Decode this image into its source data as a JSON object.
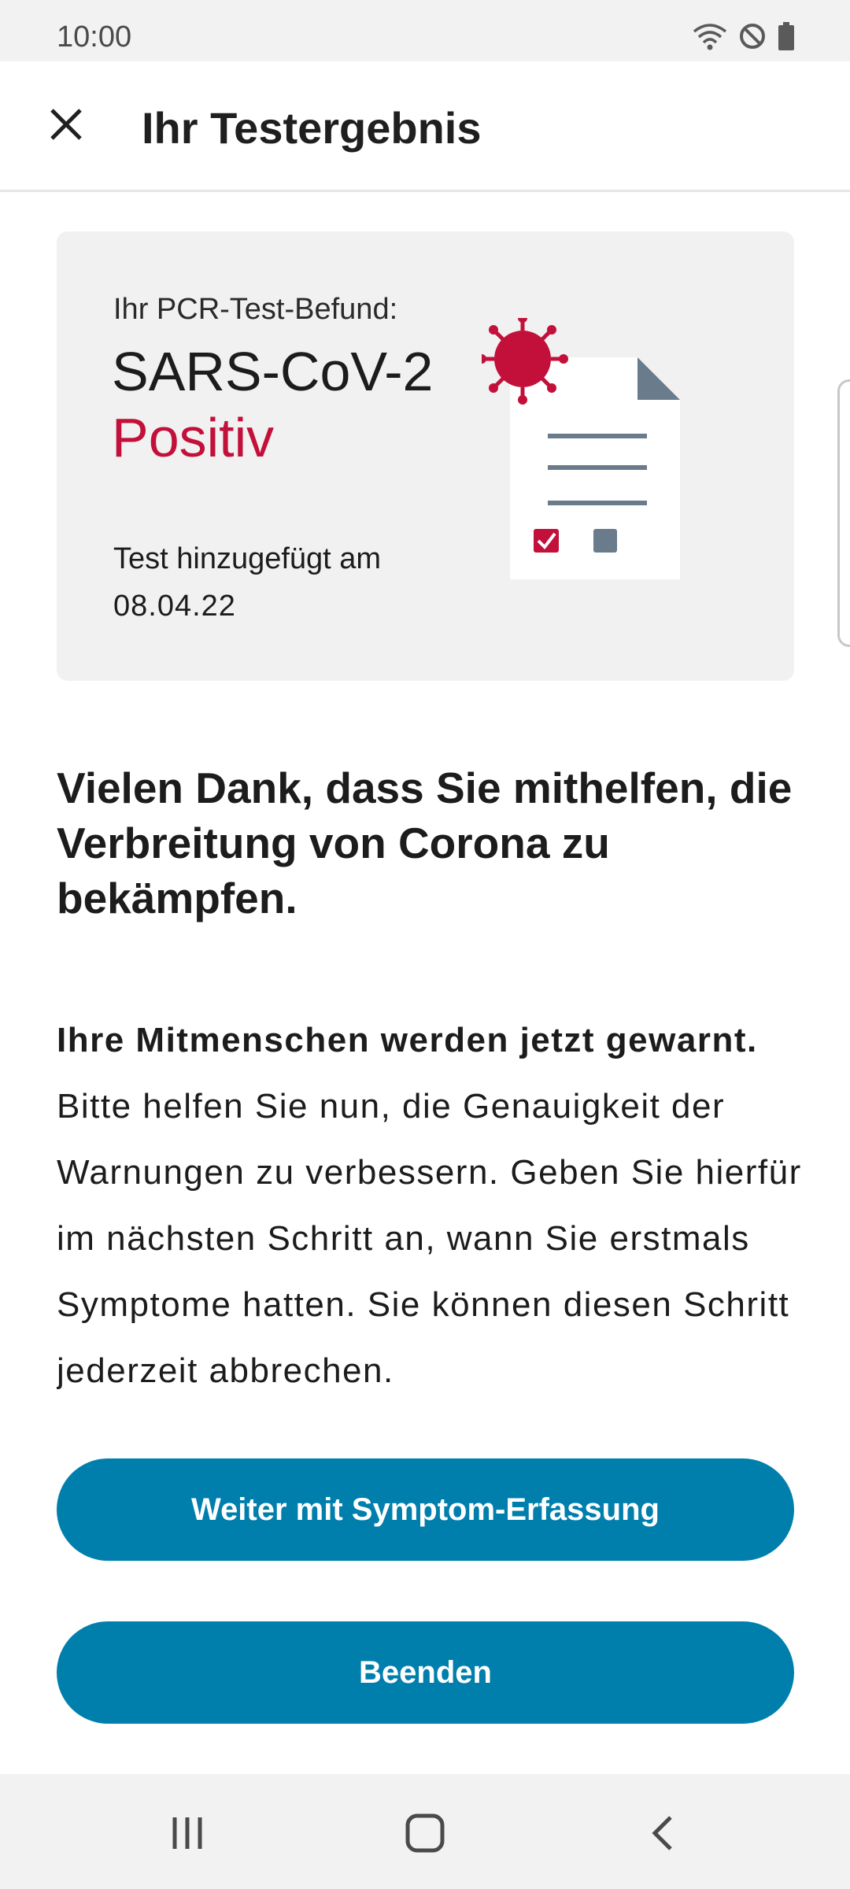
{
  "status_bar": {
    "time": "10:00",
    "icons": [
      "wifi-icon",
      "do-not-disturb-icon",
      "battery-icon"
    ]
  },
  "toolbar": {
    "title": "Ihr Testergebnis",
    "close_icon": "close-icon"
  },
  "result": {
    "label": "Ihr PCR-Test-Befund:",
    "virus": "SARS-CoV-2",
    "status": "Positiv",
    "date_label": "Test hinzugefügt am",
    "date": "08.04.22"
  },
  "content": {
    "heading": "Vielen Dank, dass Sie mithelfen, die Verbreitung von Corona zu bekämpfen.",
    "body_bold": "Ihre Mitmenschen werden jetzt gewarnt.",
    "body_rest": " Bitte helfen Sie nun, die Genauigkeit der Warnungen zu verbessern. Geben Sie hierfür im nächsten Schritt an, wann Sie erstmals Symptome hatten. Sie können diesen Schritt jederzeit abbrechen."
  },
  "buttons": {
    "symptom": "Weiter mit Symptom-Erfassung",
    "end": "Beenden"
  },
  "nav_bar": {
    "icons": [
      "recent-apps-icon",
      "home-icon",
      "back-icon"
    ]
  },
  "colors": {
    "accent": "#007fad",
    "positive": "#c2103a",
    "card_bg": "#f1f1f1",
    "doc_corner": "#6a7b8c"
  }
}
